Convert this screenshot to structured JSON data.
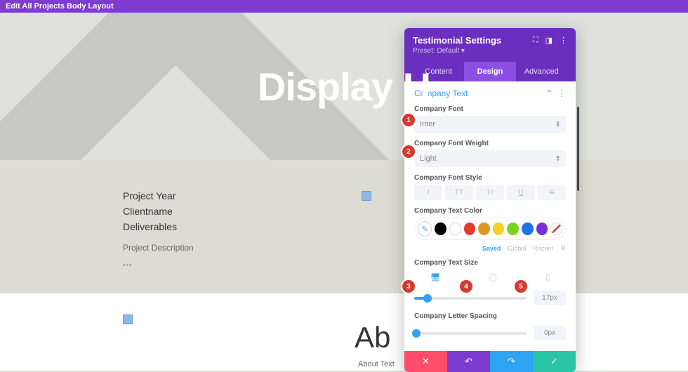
{
  "topbar": {
    "title": "Edit All Projects Body Layout"
  },
  "hero": {
    "title": "Display H"
  },
  "project": {
    "year": "Project Year",
    "client": "Clientname",
    "deliverables": "Deliverables",
    "description": "Project Description"
  },
  "about": {
    "title": "Ab",
    "subtitle": "About Text"
  },
  "panel": {
    "title": "Testimonial Settings",
    "preset_label": "Preset:",
    "preset_value": "Default",
    "tabs": {
      "content": "Content",
      "design": "Design",
      "advanced": "Advanced"
    },
    "section": "Company Text",
    "fields": {
      "font_label": "Company Font",
      "font_value": "Inter",
      "weight_label": "Company Font Weight",
      "weight_value": "Light",
      "style_label": "Company Font Style",
      "style_options": {
        "italic": "I",
        "uppercase": "TT",
        "smallcaps": "Tᴛ",
        "underline": "U",
        "strike": "S"
      },
      "color_label": "Company Text Color",
      "colors": [
        "#000000",
        "#ffffff",
        "#e23b2e",
        "#d89a1e",
        "#f5d225",
        "#7bd321",
        "#1e73e8",
        "#7a2fd6"
      ],
      "color_tabs": {
        "saved": "Saved",
        "global": "Global",
        "recent": "Recent"
      },
      "size_label": "Company Text Size",
      "size_value": "17px",
      "spacing_label": "Company Letter Spacing",
      "spacing_value": "0px"
    }
  },
  "badges": {
    "b1": "1",
    "b2": "2",
    "b3": "3",
    "b4": "4",
    "b5": "5"
  }
}
